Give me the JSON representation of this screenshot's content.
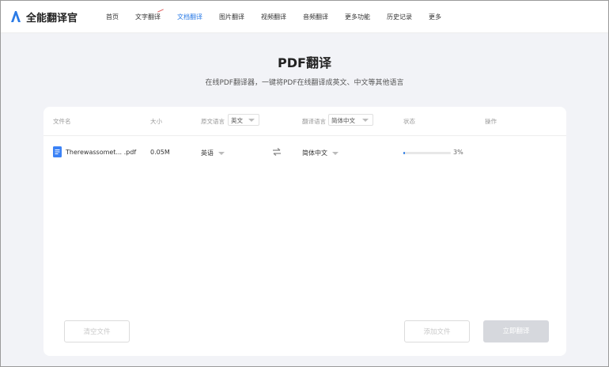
{
  "header": {
    "logo_text": "全能翻译官",
    "nav": [
      {
        "label": "首页",
        "active": false
      },
      {
        "label": "文字翻译",
        "active": false
      },
      {
        "label": "文档翻译",
        "active": true
      },
      {
        "label": "图片翻译",
        "active": false
      },
      {
        "label": "视频翻译",
        "active": false
      },
      {
        "label": "音频翻译",
        "active": false
      },
      {
        "label": "更多功能",
        "active": false
      },
      {
        "label": "历史记录",
        "active": false
      },
      {
        "label": "更多",
        "active": false
      }
    ]
  },
  "page": {
    "title": "PDF翻译",
    "subtitle": "在线PDF翻译器，一键将PDF在线翻译成英文、中文等其他语言"
  },
  "table": {
    "headers": {
      "filename": "文件名",
      "size": "大小",
      "source_lang": "原文语言",
      "source_select": "英文",
      "target_lang": "翻译语言",
      "target_select": "简体中文",
      "status": "状态",
      "action": "操作"
    },
    "rows": [
      {
        "filename": "Therewassomet... .pdf",
        "size": "0.05M",
        "source": "英语",
        "target": "简体中文",
        "progress": 3,
        "progress_label": "3%"
      }
    ]
  },
  "buttons": {
    "clear": "清空文件",
    "add": "添加文件",
    "translate": "立即翻译"
  },
  "colors": {
    "accent": "#2b7be6",
    "background": "#f2f3f7",
    "disabled_button": "#d6d8dd"
  }
}
